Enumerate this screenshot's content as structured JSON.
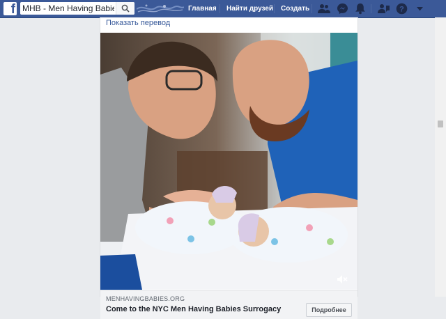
{
  "header": {
    "logo_letter": "f",
    "search": {
      "value": "MHB - Men Having Babies"
    },
    "nav": {
      "home": "Главная",
      "find_friends": "Найти друзей",
      "create": "Создать"
    },
    "icons": [
      "friend-requests-icon",
      "messenger-icon",
      "notifications-icon",
      "quick-help-icon",
      "help-icon",
      "dropdown-icon"
    ],
    "colors": {
      "bar": "#3b5998",
      "link": "#365899"
    }
  },
  "post": {
    "translate_link": "Показать перевод",
    "image_alt": "",
    "link_preview": {
      "domain": "MENHAVINGBABIES.ORG",
      "title": "Come to the NYC Men Having Babies Surrogacy",
      "button": "Подробнее"
    }
  }
}
